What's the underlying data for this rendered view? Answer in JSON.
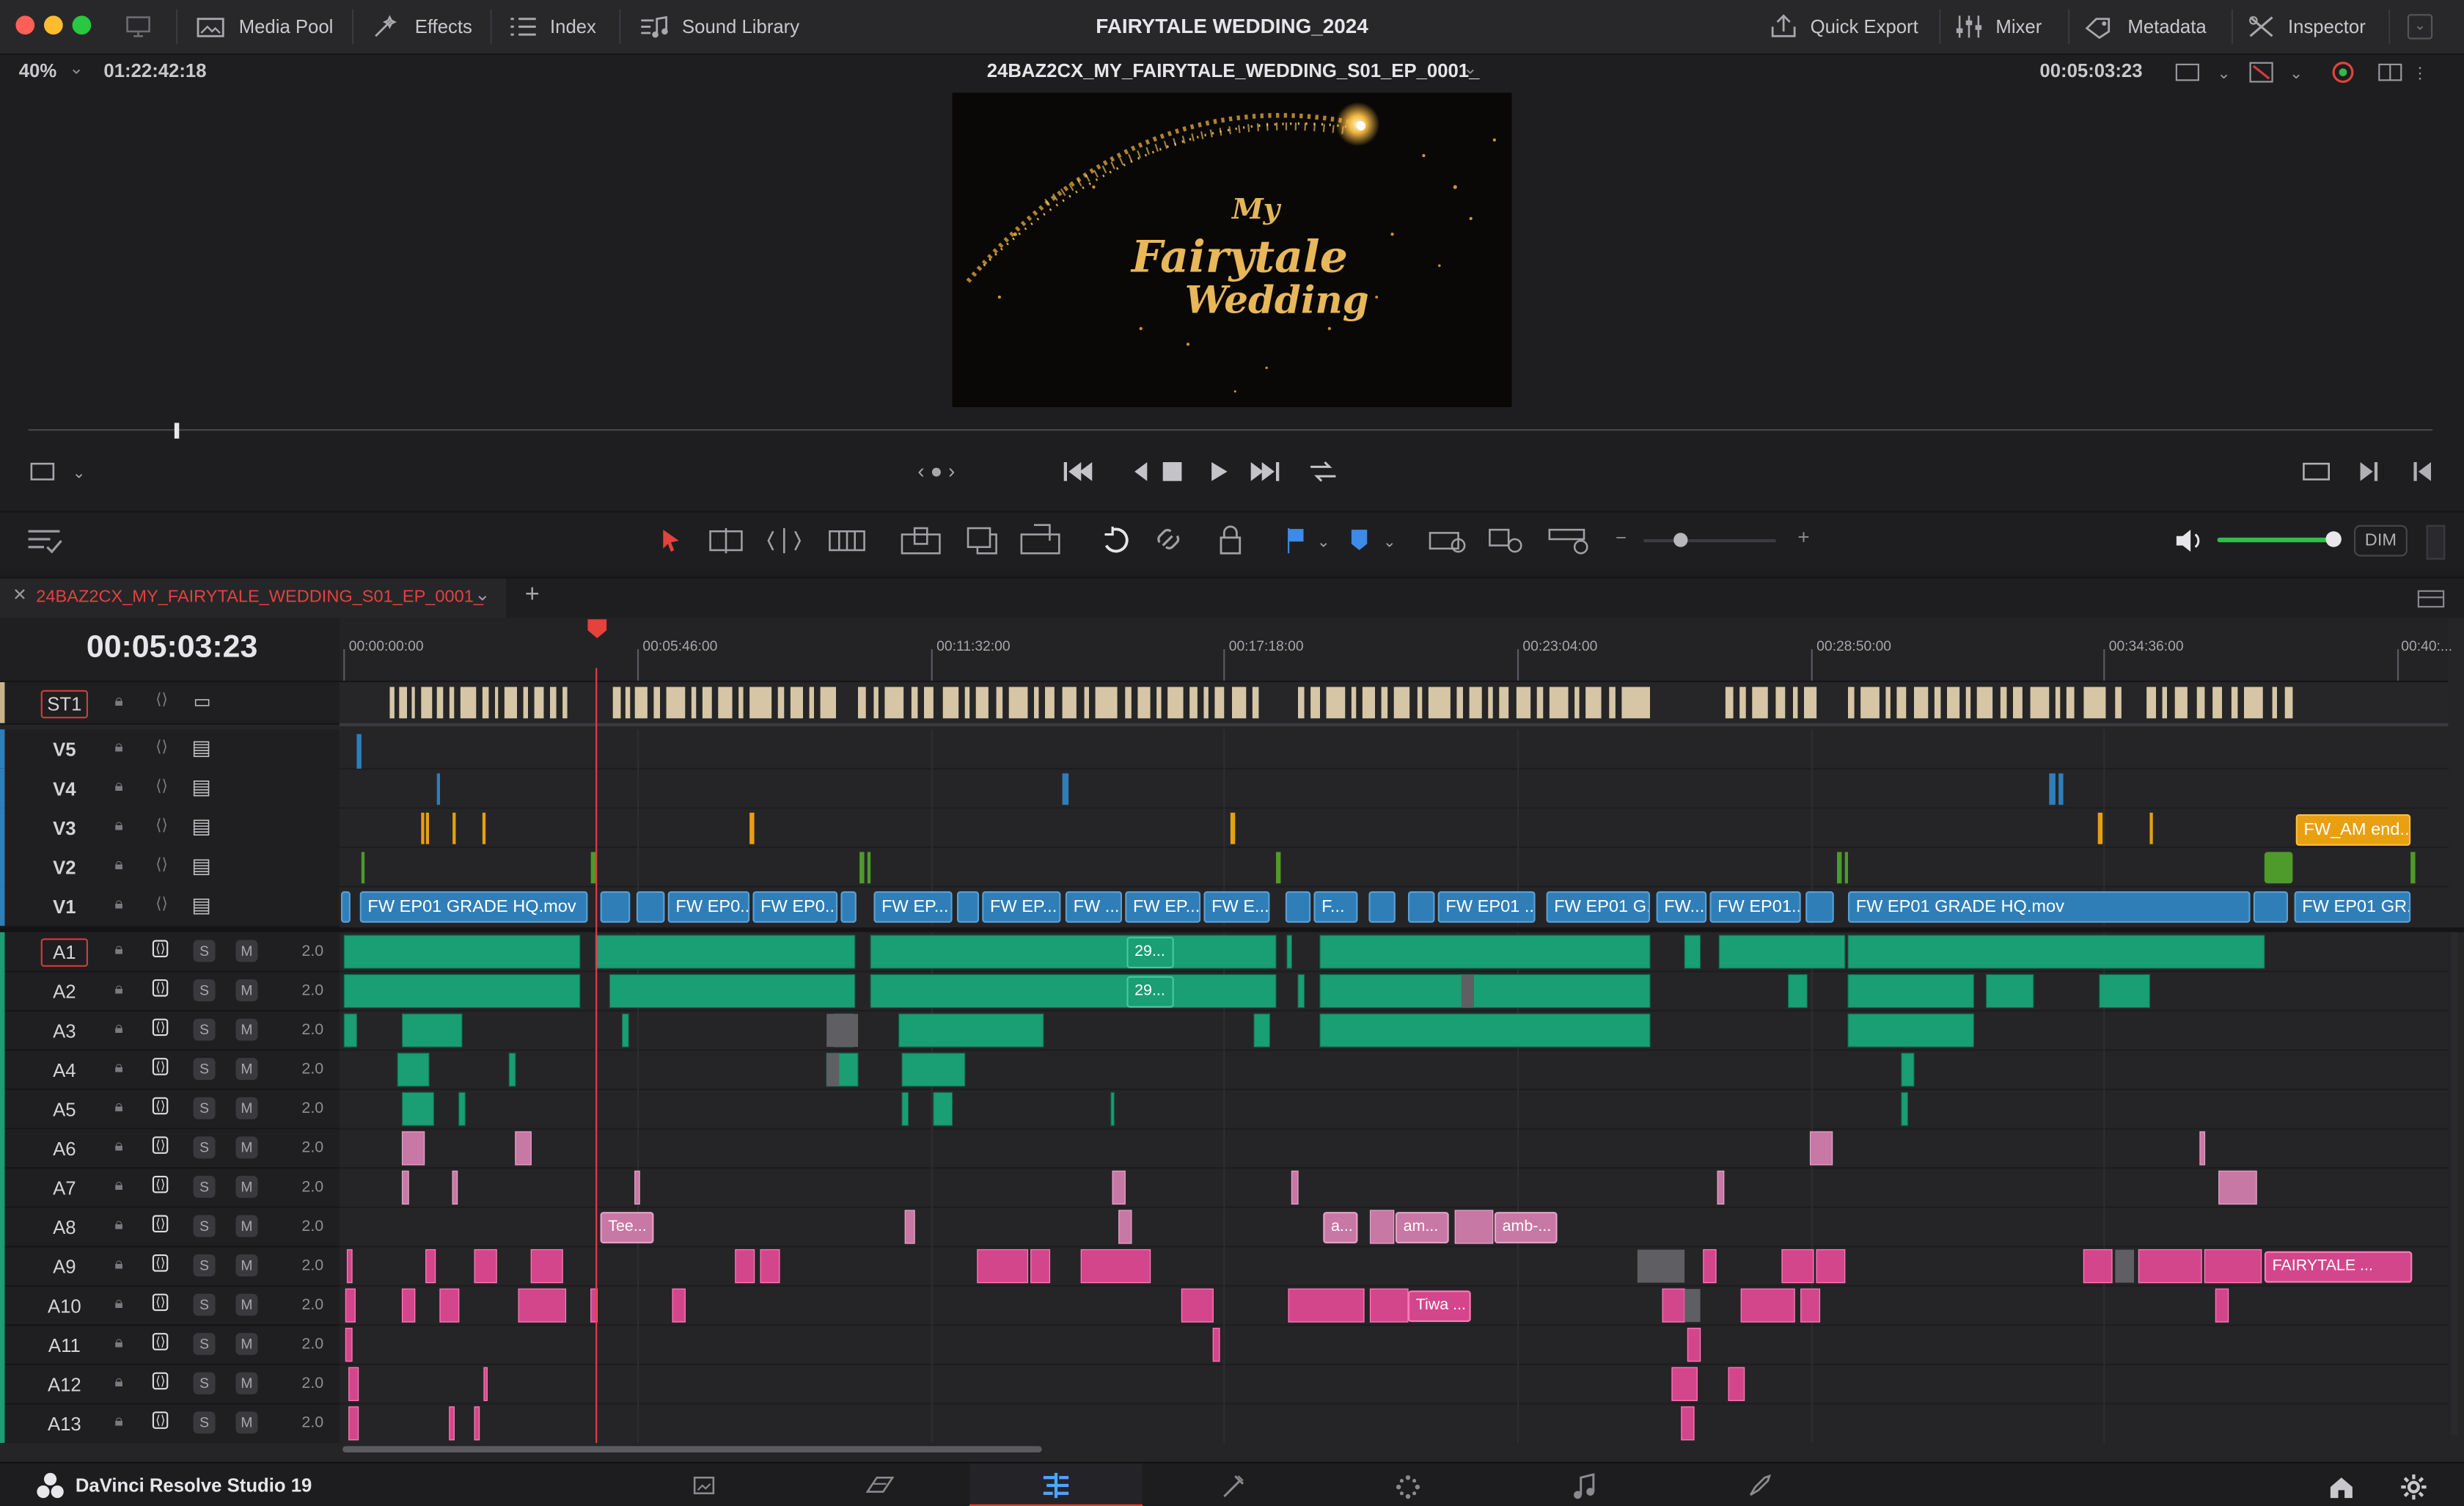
{
  "window": {
    "title": "FAIRYTALE WEDDING_2024"
  },
  "toolbar_left": [
    {
      "label": "Media Pool",
      "icon": "media-pool-icon"
    },
    {
      "label": "Effects",
      "icon": "effects-icon"
    },
    {
      "label": "Index",
      "icon": "index-icon"
    },
    {
      "label": "Sound Library",
      "icon": "sound-library-icon"
    }
  ],
  "toolbar_right": [
    {
      "label": "Quick Export",
      "icon": "export-icon"
    },
    {
      "label": "Mixer",
      "icon": "mixer-icon"
    },
    {
      "label": "Metadata",
      "icon": "metadata-icon"
    },
    {
      "label": "Inspector",
      "icon": "inspector-icon"
    }
  ],
  "viewer": {
    "zoom": "40%",
    "source_timecode": "01:22:42:18",
    "timeline_name": "24BAZ2CX_MY_FAIRYTALE_WEDDING_S01_EP_0001_",
    "record_timecode": "00:05:03:23",
    "title_card": {
      "line1": "My",
      "line2": "Fairytale",
      "line3": "Wedding"
    }
  },
  "audio": {
    "dim_label": "DIM"
  },
  "timeline": {
    "tab_label": "24BAZ2CX_MY_FAIRYTALE_WEDDING_S01_EP_0001_",
    "timecode": "00:05:03:23",
    "ruler": [
      "00:00:00:00",
      "00:05:46:00",
      "00:11:32:00",
      "00:17:18:00",
      "00:23:04:00",
      "00:28:50:00",
      "00:34:36:00",
      "00:40:..."
    ],
    "subtitle_track": "ST1",
    "video_tracks": [
      "V5",
      "V4",
      "V3",
      "V2",
      "V1"
    ],
    "audio_tracks": [
      "A1",
      "A2",
      "A3",
      "A4",
      "A5",
      "A6",
      "A7",
      "A8",
      "A9",
      "A10",
      "A11",
      "A12",
      "A13"
    ],
    "audio_level": "2.0",
    "solo_label": "S",
    "mute_label": "M",
    "v1_clips": [
      "FW EP01 GRADE HQ.mov",
      "FW EP0...",
      "FW EP0...",
      "FW EP...",
      "FW EP...",
      "FW ...",
      "FW EP...",
      "FW E...",
      "F...",
      "FW EP01 ...",
      "FW EP01 G...",
      "FW...",
      "FW EP01...",
      "FW EP01 GRADE HQ.mov",
      "FW EP01 GR..."
    ],
    "v3_clip": "FW_AM end...",
    "audio_labels": {
      "a1": "29...",
      "a2": "29...",
      "a8_1": "Tee...",
      "a8_2": "a...",
      "a8_3": "am...",
      "a8_4": "amb-...",
      "a9": "FAIRYTALE ...",
      "a10": "Tiwa ..."
    }
  },
  "app": {
    "name": "DaVinci Resolve Studio 19"
  },
  "colors": {
    "accent_red": "#e5413d",
    "video_blue": "#2f7eb8",
    "audio_green": "#1a9e74",
    "audio_pink": "#d4468b",
    "v3_orange": "#e8a010",
    "subtitle_tan": "#d6c6a5"
  }
}
